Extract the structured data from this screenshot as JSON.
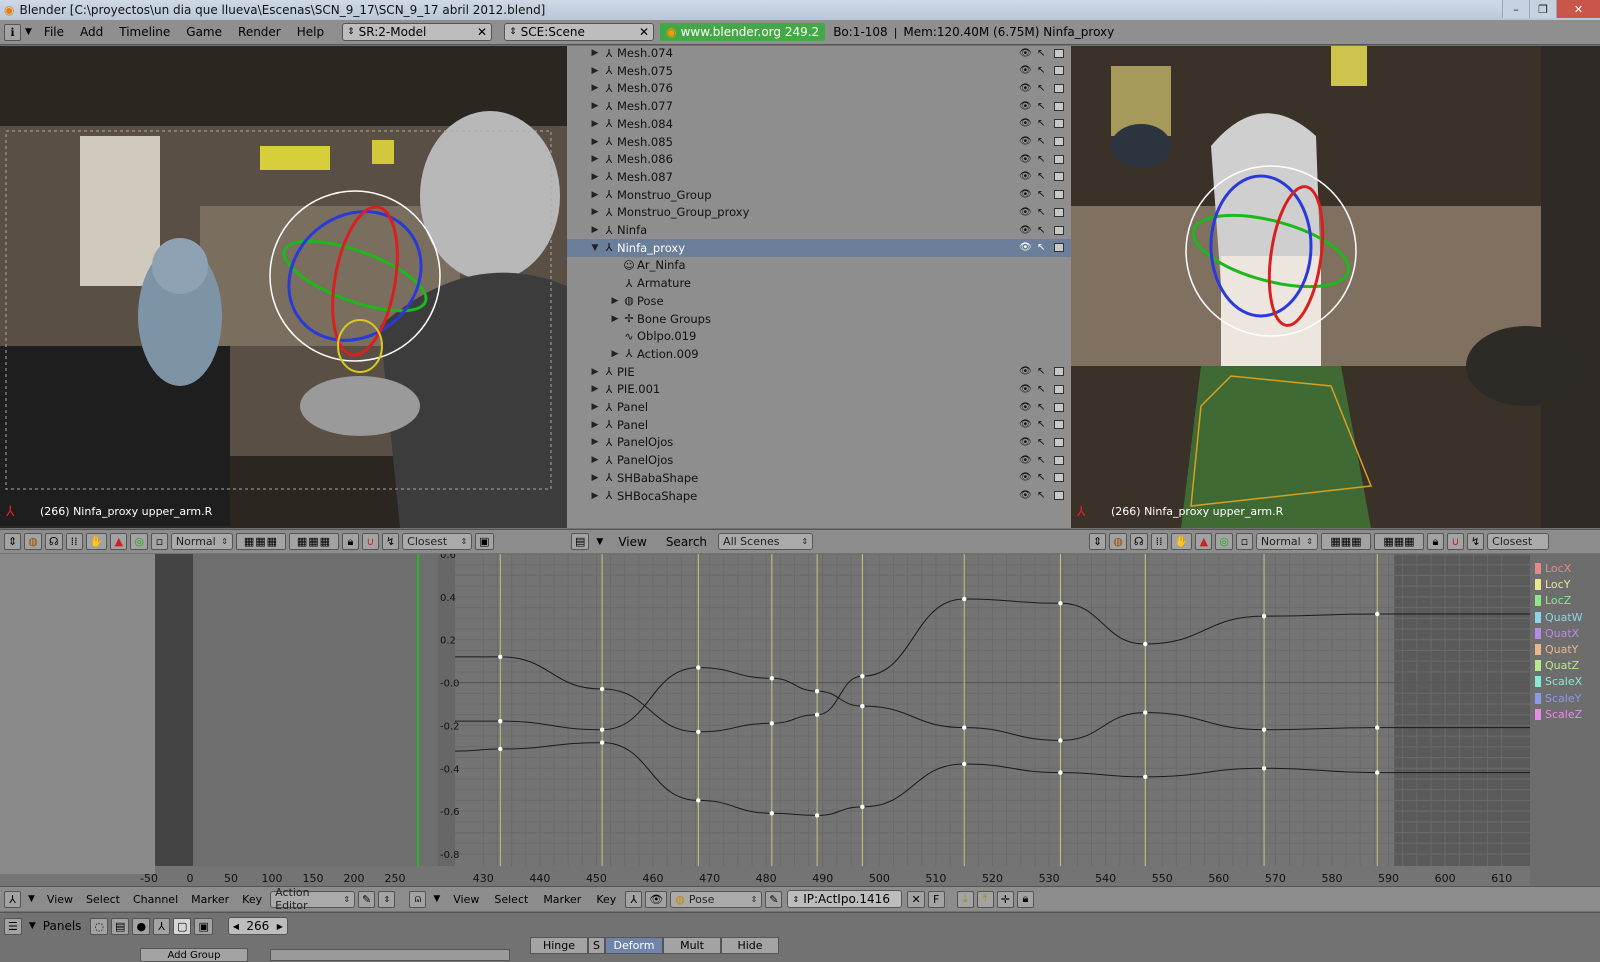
{
  "window": {
    "title": "Blender [C:\\proyectos\\un dia que llueva\\Escenas\\SCN_9_17\\SCN_9_17 abril 2012.blend]",
    "controls": [
      "–",
      "❐",
      "✕"
    ]
  },
  "topbar": {
    "menus": [
      "File",
      "Add",
      "Timeline",
      "Game",
      "Render",
      "Help"
    ],
    "screen": "SR:2-Model",
    "scene": "SCE:Scene",
    "website": "www.blender.org 249.2",
    "stats": "Bo:1-108",
    "mem": "Mem:120.40M (6.75M) Ninfa_proxy"
  },
  "viewport_left": {
    "label": "(266) Ninfa_proxy upper_arm.R",
    "mode": "Normal",
    "snap": "Closest"
  },
  "viewport_right": {
    "label": "(266) Ninfa_proxy upper_arm.R",
    "mode": "Normal",
    "snap": "Closest"
  },
  "outliner": {
    "header": {
      "view": "View",
      "search": "Search",
      "scope": "All Scenes"
    },
    "rows": [
      {
        "name": "Mesh.074",
        "indent": 0,
        "icon": "mesh"
      },
      {
        "name": "Mesh.075",
        "indent": 0,
        "icon": "mesh"
      },
      {
        "name": "Mesh.076",
        "indent": 0,
        "icon": "mesh"
      },
      {
        "name": "Mesh.077",
        "indent": 0,
        "icon": "mesh"
      },
      {
        "name": "Mesh.084",
        "indent": 0,
        "icon": "mesh"
      },
      {
        "name": "Mesh.085",
        "indent": 0,
        "icon": "mesh"
      },
      {
        "name": "Mesh.086",
        "indent": 0,
        "icon": "mesh"
      },
      {
        "name": "Mesh.087",
        "indent": 0,
        "icon": "mesh"
      },
      {
        "name": "Monstruo_Group",
        "indent": 0,
        "icon": "mesh"
      },
      {
        "name": "Monstruo_Group_proxy",
        "indent": 0,
        "icon": "mesh"
      },
      {
        "name": "Ninfa",
        "indent": 0,
        "icon": "mesh"
      },
      {
        "name": "Ninfa_proxy",
        "indent": 0,
        "icon": "mesh",
        "selected": true,
        "expanded": true
      },
      {
        "name": "Ar_Ninfa",
        "indent": 1,
        "icon": "ghost"
      },
      {
        "name": "Armature",
        "indent": 1,
        "icon": "armature"
      },
      {
        "name": "Pose",
        "indent": 1,
        "icon": "pose",
        "expandable": true
      },
      {
        "name": "Bone Groups",
        "indent": 1,
        "icon": "bonegroup",
        "expandable": true
      },
      {
        "name": "Oblpo.019",
        "indent": 1,
        "icon": "ipo"
      },
      {
        "name": "Action.009",
        "indent": 1,
        "icon": "action",
        "expandable": true
      },
      {
        "name": "PIE",
        "indent": 0,
        "icon": "mesh"
      },
      {
        "name": "PIE.001",
        "indent": 0,
        "icon": "mesh"
      },
      {
        "name": "Panel",
        "indent": 0,
        "icon": "mesh"
      },
      {
        "name": "Panel",
        "indent": 0,
        "icon": "mesh"
      },
      {
        "name": "PanelOjos",
        "indent": 0,
        "icon": "mesh"
      },
      {
        "name": "PanelOjos",
        "indent": 0,
        "icon": "mesh"
      },
      {
        "name": "SHBabaShape",
        "indent": 0,
        "icon": "mesh"
      },
      {
        "name": "SHBocaShape",
        "indent": 0,
        "icon": "mesh"
      }
    ]
  },
  "action_editor": {
    "menus": [
      "View",
      "Select",
      "Channel",
      "Marker",
      "Key"
    ],
    "editor_type": "Action Editor",
    "ticks": [
      "-50",
      "0",
      "50",
      "100",
      "150",
      "200",
      "250"
    ]
  },
  "ipo_editor": {
    "menus": [
      "View",
      "Select",
      "Marker",
      "Key"
    ],
    "pose": "Pose",
    "ipo": "IP:ActIpo.1416",
    "fake_user": "F"
  },
  "bottom": {
    "panels_label": "Panels",
    "frame": "266",
    "add_group": "Add Group",
    "buttons": [
      "Hinge",
      "S",
      "Deform",
      "Mult",
      "Hide"
    ]
  },
  "chart_data": {
    "type": "line",
    "x_range": [
      425,
      615
    ],
    "y_range": [
      -0.8,
      0.6
    ],
    "x_ticks": [
      "430",
      "440",
      "450",
      "460",
      "470",
      "480",
      "490",
      "500",
      "510",
      "520",
      "530",
      "540",
      "550",
      "560",
      "570",
      "580",
      "590",
      "600",
      "610"
    ],
    "y_ticks": [
      "0.6",
      "0.4",
      "0.2",
      "-0.0",
      "-0.2",
      "-0.4",
      "-0.6",
      "-0.8"
    ],
    "keyframe_x": [
      433,
      451,
      468,
      481,
      489,
      497,
      515,
      532,
      547,
      568,
      588
    ],
    "legend": [
      {
        "name": "LocX",
        "color": "#e88888"
      },
      {
        "name": "LocY",
        "color": "#e8e88a"
      },
      {
        "name": "LocZ",
        "color": "#8ae88a"
      },
      {
        "name": "QuatW",
        "color": "#8ad6e8"
      },
      {
        "name": "QuatX",
        "color": "#b88ae8"
      },
      {
        "name": "QuatY",
        "color": "#e8b88a"
      },
      {
        "name": "QuatZ",
        "color": "#b8e88a"
      },
      {
        "name": "ScaleX",
        "color": "#8ae8d6"
      },
      {
        "name": "ScaleY",
        "color": "#8a9ae8"
      },
      {
        "name": "ScaleZ",
        "color": "#e88ae8"
      }
    ],
    "series": [
      {
        "x": [
          425,
          433,
          451,
          468,
          481,
          489,
          497,
          515,
          532,
          547,
          568,
          588,
          615
        ],
        "values": [
          0.12,
          0.12,
          -0.03,
          -0.23,
          -0.19,
          -0.15,
          0.03,
          0.39,
          0.37,
          0.18,
          0.31,
          0.32,
          0.32
        ]
      },
      {
        "x": [
          425,
          433,
          451,
          468,
          481,
          489,
          497,
          515,
          532,
          547,
          568,
          588,
          615
        ],
        "values": [
          -0.18,
          -0.18,
          -0.22,
          0.07,
          0.02,
          -0.04,
          -0.11,
          -0.21,
          -0.27,
          -0.14,
          -0.22,
          -0.21,
          -0.21
        ]
      },
      {
        "x": [
          425,
          433,
          451,
          468,
          481,
          489,
          497,
          515,
          532,
          547,
          568,
          588,
          615
        ],
        "values": [
          -0.32,
          -0.31,
          -0.28,
          -0.55,
          -0.61,
          -0.62,
          -0.58,
          -0.38,
          -0.42,
          -0.44,
          -0.4,
          -0.42,
          -0.42
        ]
      }
    ]
  }
}
